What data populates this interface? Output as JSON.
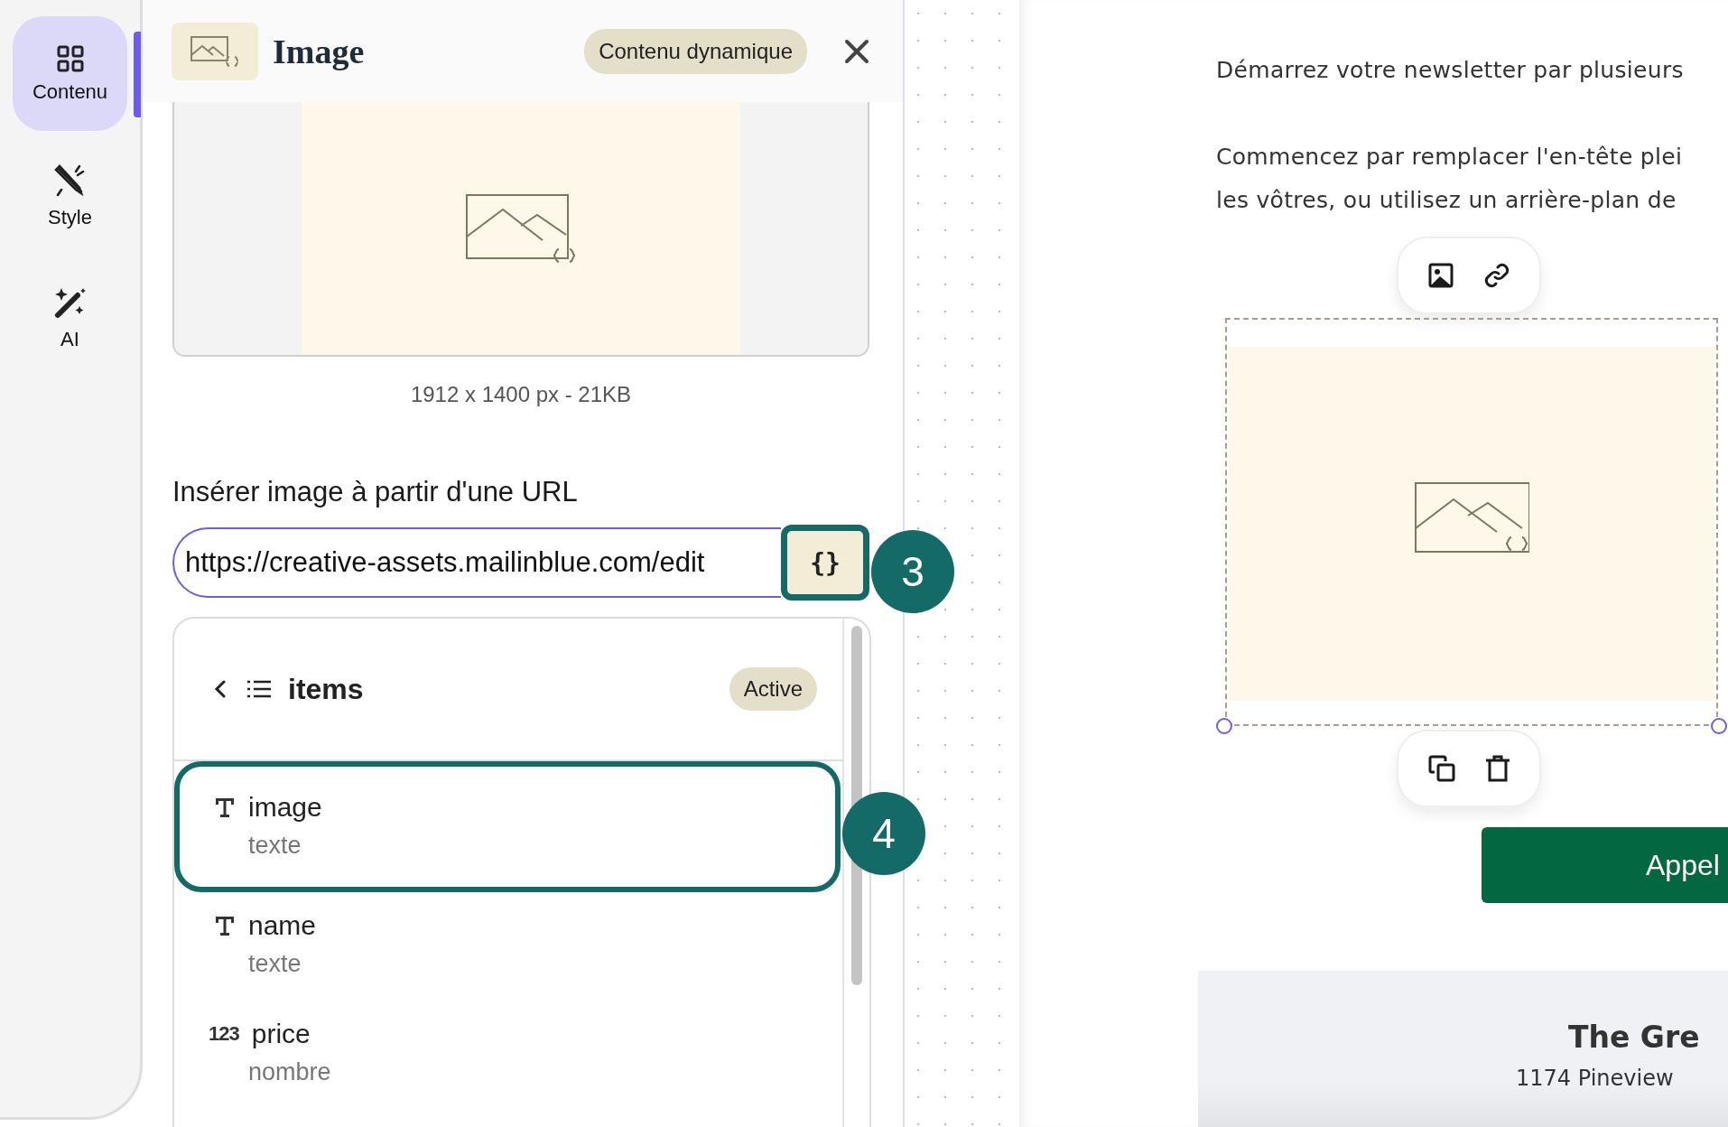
{
  "nav_rail": {
    "items": [
      {
        "label": "Contenu",
        "selected": true
      },
      {
        "label": "Style",
        "selected": false
      },
      {
        "label": "AI",
        "selected": false
      }
    ]
  },
  "panel": {
    "title": "Image",
    "badge": "Contenu dynamique",
    "image_info": "1912 x 1400 px - 21KB",
    "url_label": "Insérer image à partir d'une URL",
    "url_value": "https://creative-assets.mailinblue.com/edit",
    "dynamic_button": "{}"
  },
  "callouts": [
    "3",
    "4"
  ],
  "dropdown": {
    "title": "items",
    "badge": "Active",
    "fields": [
      {
        "name": "image",
        "type": "texte",
        "kind": "text",
        "selected": true
      },
      {
        "name": "name",
        "type": "texte",
        "kind": "text",
        "selected": false
      },
      {
        "name": "price",
        "type": "nombre",
        "kind": "number",
        "icon_label": "123",
        "selected": false
      }
    ]
  },
  "email": {
    "lines": [
      "Démarrez votre newsletter par plusieurs",
      "Commencez par remplacer l'en-tête plei",
      "les vôtres, ou utilisez un arrière-plan de"
    ],
    "cta": "Appel",
    "footer": {
      "name": "The Gre",
      "address": "1174 Pineview"
    }
  }
}
